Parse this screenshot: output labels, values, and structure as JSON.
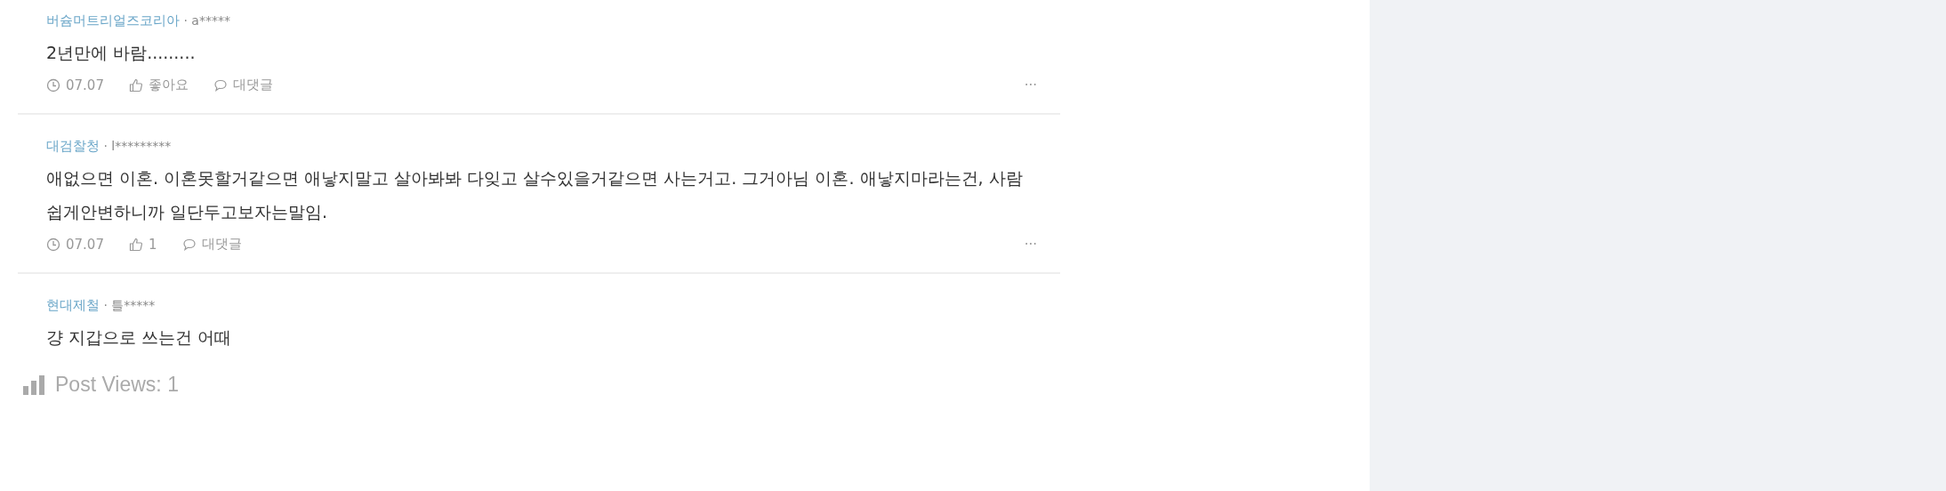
{
  "comments": [
    {
      "company": "버슘머트리얼즈코리아",
      "author": "· a*****",
      "text": "2년만에 바람.........",
      "actions": {
        "date": "07.07",
        "likes": "좋아요",
        "reply": "대댓글",
        "more": "···"
      }
    },
    {
      "company": "대검찰청",
      "author": "· l*********",
      "text": "애없으면 이혼. 이혼못할거같으면 애낳지말고 살아봐봐 다잊고 살수있을거같으면 사는거고. 그거아님 이혼. 애낳지마라는건, 사람 쉽게안변하니까 일단두고보자는말임.",
      "actions": {
        "date": "07.07",
        "likes": "1",
        "reply": "대댓글",
        "more": "···"
      }
    },
    {
      "company": "현대제철",
      "author": "· 틀*****",
      "text": "걍 지갑으로 쓰는건 어때"
    }
  ],
  "post_views": "Post Views: 1"
}
